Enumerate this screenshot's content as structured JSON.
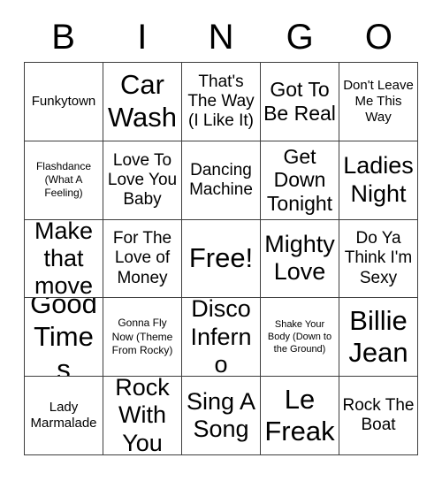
{
  "card": {
    "title": "BINGO Card",
    "header_letters": [
      "B",
      "I",
      "N",
      "G",
      "O"
    ],
    "grid_size": "5x5",
    "border_color": "#3d3d3d",
    "cell_background": "#ffffff",
    "text_color": "#000000",
    "free_space": {
      "row": 3,
      "column": 3,
      "label": "Free!"
    },
    "rows": [
      [
        {
          "label": "Funkytown",
          "size": "sm"
        },
        {
          "label": "Car Wash",
          "size": "xxl"
        },
        {
          "label": "That's The Way (I Like It)",
          "size": "md"
        },
        {
          "label": "Got To Be Real",
          "size": "lg"
        },
        {
          "label": "Don't Leave Me This Way",
          "size": "sm"
        }
      ],
      [
        {
          "label": "Flashdance (What A Feeling)",
          "size": "xs"
        },
        {
          "label": "Love To Love You Baby",
          "size": "md"
        },
        {
          "label": "Dancing Machine",
          "size": "md"
        },
        {
          "label": "Get Down Tonight",
          "size": "lg"
        },
        {
          "label": "Ladies Night",
          "size": "xl"
        }
      ],
      [
        {
          "label": "Make that move",
          "size": "xl"
        },
        {
          "label": "For The Love of Money",
          "size": "md"
        },
        {
          "label": "Free!",
          "size": "xxl"
        },
        {
          "label": "Mighty Love",
          "size": "xl"
        },
        {
          "label": "Do Ya Think I'm Sexy",
          "size": "md"
        }
      ],
      [
        {
          "label": "Good Times",
          "size": "xxl"
        },
        {
          "label": "Gonna Fly Now (Theme From Rocky)",
          "size": "xs"
        },
        {
          "label": "Disco Inferno",
          "size": "xl"
        },
        {
          "label": "Shake Your Body (Down to the Ground)",
          "size": "xxs"
        },
        {
          "label": "Billie Jean",
          "size": "xxl"
        }
      ],
      [
        {
          "label": "Lady Marmalade",
          "size": "sm"
        },
        {
          "label": "Rock With You",
          "size": "xl"
        },
        {
          "label": "Sing A Song",
          "size": "xl"
        },
        {
          "label": "Le Freak",
          "size": "xxl"
        },
        {
          "label": "Rock The Boat",
          "size": "md"
        }
      ]
    ]
  }
}
